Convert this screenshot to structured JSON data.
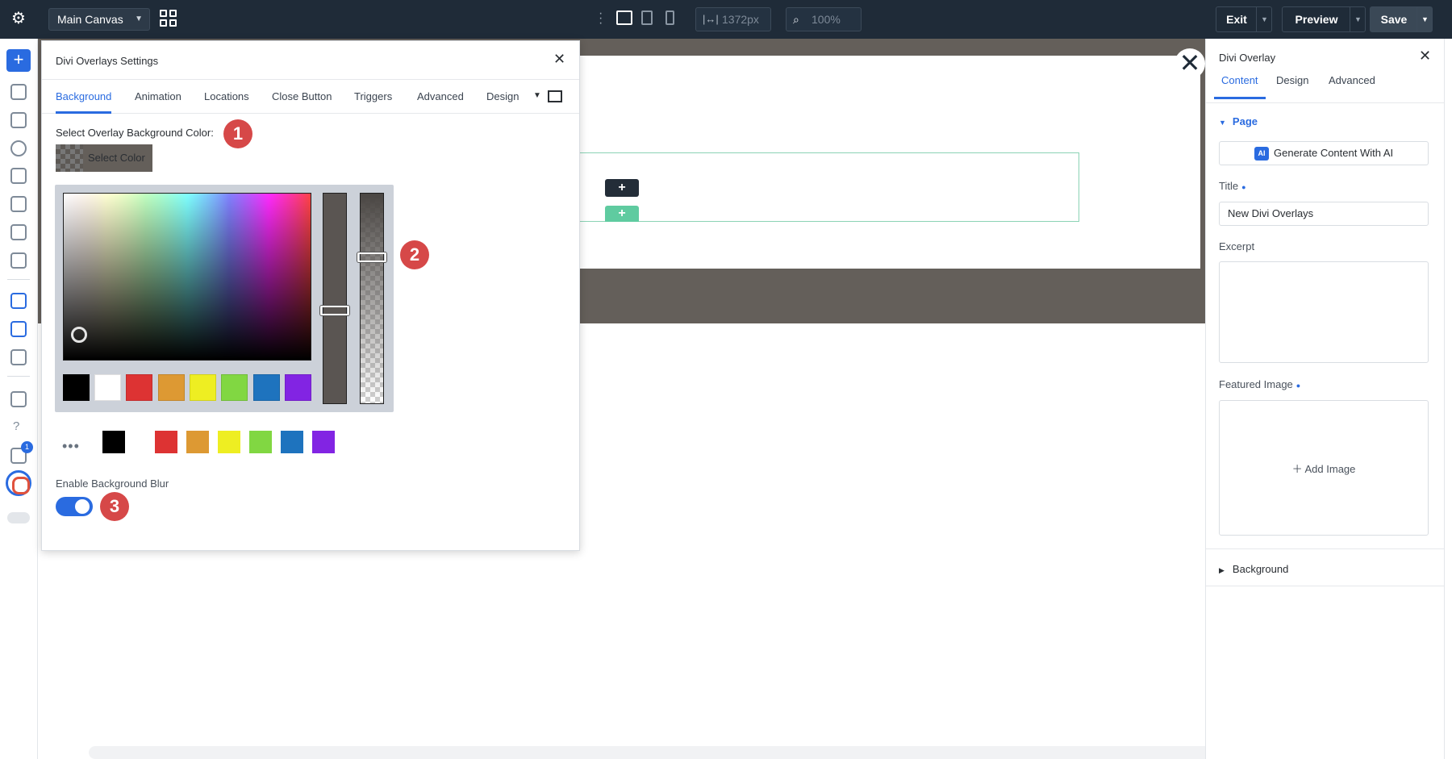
{
  "topbar": {
    "canvas_select": "Main Canvas",
    "width_value": "1372px",
    "zoom_value": "100%",
    "exit_label": "Exit",
    "preview_label": "Preview",
    "save_label": "Save"
  },
  "lefttool": {
    "notification_count": "1"
  },
  "modal": {
    "title": "Divi Overlays Settings",
    "tabs": [
      "Background",
      "Animation",
      "Locations",
      "Close Button",
      "Triggers",
      "Advanced",
      "Design"
    ],
    "active_tab": "Background",
    "bg_color_label": "Select Overlay Background Color:",
    "select_color_label": "Select Color",
    "current_color": "#645f5a",
    "picker_swatches": [
      "#000000",
      "#ffffff",
      "#dd3333",
      "#dd9933",
      "#eeee22",
      "#81d742",
      "#1e73be",
      "#8224e3"
    ],
    "palette_swatches": [
      "#000000",
      "#dd3333",
      "#dd9933",
      "#eeee22",
      "#81d742",
      "#1e73be",
      "#8224e3"
    ],
    "blur_label": "Enable Background Blur",
    "blur_enabled": true
  },
  "markers": [
    "1",
    "2",
    "3"
  ],
  "rpanel": {
    "title": "Divi Overlay",
    "tabs": [
      "Content",
      "Design",
      "Advanced"
    ],
    "active_tab": "Content",
    "section": "Page",
    "ai_label": "Generate Content With AI",
    "ai_badge": "AI",
    "title_label": "Title",
    "title_value": "New Divi Overlays",
    "excerpt_label": "Excerpt",
    "featured_label": "Featured Image",
    "add_image_label": "Add Image",
    "background_label": "Background"
  },
  "colors": {
    "accent": "#2a6be0",
    "topbar": "#1f2b38",
    "marker": "#d64848",
    "canvas_band": "#645f5a",
    "row_border": "#8bd3b5"
  }
}
